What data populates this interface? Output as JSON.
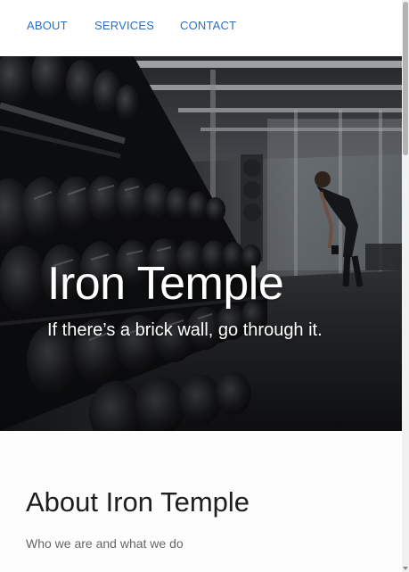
{
  "nav": {
    "about_label": "ABOUT",
    "services_label": "SERVICES",
    "contact_label": "CONTACT"
  },
  "hero": {
    "title": "Iron Temple",
    "subtitle": "If there’s a brick wall, go through it."
  },
  "about": {
    "title": "About Iron Temple",
    "subtitle": "Who we are and what we do"
  },
  "colors": {
    "nav_link": "#2a6fc4",
    "hero_text": "#ffffff",
    "heading": "#1e1e1e",
    "muted_text": "#666666"
  }
}
